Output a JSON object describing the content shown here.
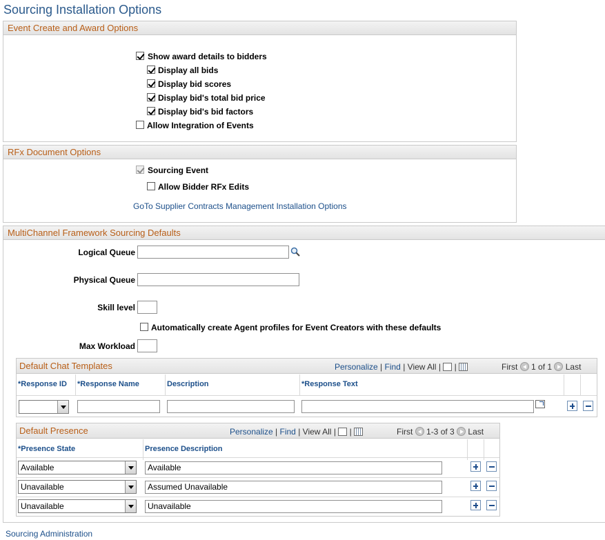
{
  "page": {
    "title": "Sourcing Installation Options"
  },
  "event_options": {
    "header": "Event Create and Award Options",
    "items": [
      {
        "label": "Show award details to bidders",
        "checked": true
      },
      {
        "label": "Display all bids",
        "checked": true
      },
      {
        "label": "Display bid scores",
        "checked": true
      },
      {
        "label": "Display bid's total bid price",
        "checked": true
      },
      {
        "label": "Display bid's bid factors",
        "checked": true
      },
      {
        "label": "Allow Integration of Events",
        "checked": false
      }
    ]
  },
  "rfx_options": {
    "header": "RFx Document Options",
    "sourcing_event": "Sourcing Event",
    "allow_edits": "Allow Bidder RFx Edits",
    "goto_link": "GoTo Supplier Contracts Management Installation Options"
  },
  "mcf": {
    "header": "MultiChannel Framework Sourcing Defaults",
    "logical_queue": {
      "label": "Logical Queue",
      "value": ""
    },
    "physical_queue": {
      "label": "Physical Queue",
      "value": ""
    },
    "skill_level": {
      "label": "Skill level",
      "value": ""
    },
    "auto_create": "Automatically create Agent profiles for Event Creators with these defaults",
    "max_workload": {
      "label": "Max Workload",
      "value": ""
    }
  },
  "chat_templates": {
    "title": "Default Chat Templates",
    "personalize": "Personalize",
    "find": "Find",
    "sep": "|",
    "view_all": "View All",
    "first": "First",
    "range": "1 of 1",
    "last": "Last",
    "columns": [
      "*Response ID",
      "*Response Name",
      "Description",
      "*Response Text"
    ],
    "row": {
      "response_id": "",
      "response_name": "",
      "description": "",
      "response_text": ""
    }
  },
  "presence": {
    "title": "Default Presence",
    "personalize": "Personalize",
    "find": "Find",
    "sep": "|",
    "view_all": "View All",
    "first": "First",
    "range": "1-3 of 3",
    "last": "Last",
    "columns": [
      "*Presence State",
      "Presence Description"
    ],
    "rows": [
      {
        "state": "Available",
        "description": "Available"
      },
      {
        "state": "Unavailable",
        "description": "Assumed Unavailable"
      },
      {
        "state": "Unavailable",
        "description": "Unavailable"
      }
    ]
  },
  "footer": {
    "link": "Sourcing Administration"
  },
  "colors": {
    "title": "#2b5a8c",
    "section_header": "#b85e17",
    "link": "#1c4f8a"
  }
}
